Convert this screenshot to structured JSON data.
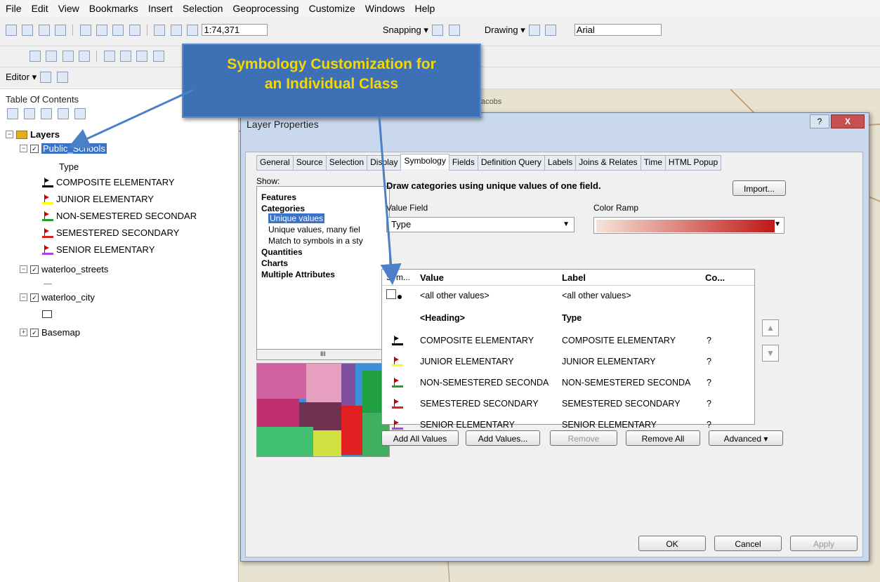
{
  "menu": [
    "File",
    "Edit",
    "View",
    "Bookmarks",
    "Insert",
    "Selection",
    "Geoprocessing",
    "Customize",
    "Windows",
    "Help"
  ],
  "toolbar1": {
    "scale": "1:74,371",
    "snapping": "Snapping ▾",
    "drawing": "Drawing ▾",
    "font": "Arial"
  },
  "toolbar3": {
    "editor": "Editor ▾"
  },
  "toc": {
    "title": "Table Of Contents",
    "layers_label": "Layers",
    "layer1": "Public_Schools",
    "field": "Type",
    "classes": [
      {
        "label": "COMPOSITE ELEMENTARY",
        "color": "#000000"
      },
      {
        "label": "JUNIOR ELEMENTARY",
        "color": "#ffff00"
      },
      {
        "label": "NON-SEMESTERED SECONDAR",
        "color": "#22a022"
      },
      {
        "label": "SEMESTERED SECONDARY",
        "color": "#e02020"
      },
      {
        "label": "SENIOR ELEMENTARY",
        "color": "#b040e0"
      }
    ],
    "layer2": "waterloo_streets",
    "layer3": "waterloo_city",
    "layer4": "Basemap"
  },
  "map": {
    "place1": "St Jacobs"
  },
  "callout": {
    "line1": "Symbology Customization for",
    "line2": "an Individual Class"
  },
  "dialog": {
    "title": "Layer Properties",
    "help": "?",
    "close": "X",
    "tabs": [
      "General",
      "Source",
      "Selection",
      "Display",
      "Symbology",
      "Fields",
      "Definition Query",
      "Labels",
      "Joins & Relates",
      "Time",
      "HTML Popup"
    ],
    "active_tab": "Symbology",
    "show_label": "Show:",
    "show_items": [
      "Features",
      "Categories",
      "Unique values",
      "Unique values, many fiel",
      "Match to symbols in a sty",
      "Quantities",
      "Charts",
      "Multiple Attributes"
    ],
    "scroll_thumb": "III",
    "draw_label": "Draw categories using unique values of one field.",
    "import_btn": "Import...",
    "value_field_label": "Value Field",
    "value_field": "Type",
    "color_ramp_label": "Color Ramp",
    "table_headers": {
      "sym": "Sym...",
      "value": "Value",
      "label": "Label",
      "count": "Co..."
    },
    "other_value": "<all other values>",
    "other_label": "<all other values>",
    "heading_value": "<Heading>",
    "heading_label": "Type",
    "rows": [
      {
        "value": "COMPOSITE ELEMENTARY",
        "label": "COMPOSITE ELEMENTARY",
        "count": "?",
        "color": "#000000"
      },
      {
        "value": "JUNIOR ELEMENTARY",
        "label": "JUNIOR ELEMENTARY",
        "count": "?",
        "color": "#ffff00"
      },
      {
        "value": "NON-SEMESTERED SECONDA",
        "label": "NON-SEMESTERED SECONDA",
        "count": "?",
        "color": "#22a022"
      },
      {
        "value": "SEMESTERED SECONDARY",
        "label": "SEMESTERED SECONDARY",
        "count": "?",
        "color": "#e02020"
      },
      {
        "value": "SENIOR ELEMENTARY",
        "label": "SENIOR ELEMENTARY",
        "count": "?",
        "color": "#b040e0"
      }
    ],
    "buttons": {
      "add_all": "Add All Values",
      "add": "Add Values...",
      "remove": "Remove",
      "remove_all": "Remove All",
      "advanced": "Advanced ▾",
      "ok": "OK",
      "cancel": "Cancel",
      "apply": "Apply"
    }
  }
}
